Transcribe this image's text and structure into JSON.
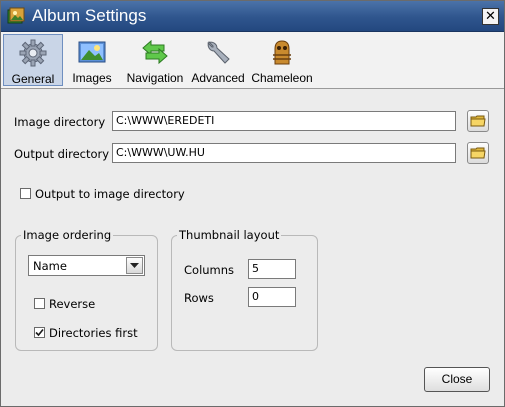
{
  "window": {
    "title": "Album Settings",
    "close_symbol": "✕"
  },
  "toolbar": {
    "tabs": [
      {
        "label": "General",
        "icon": "gear-icon",
        "selected": true
      },
      {
        "label": "Images",
        "icon": "picture-icon",
        "selected": false
      },
      {
        "label": "Navigation",
        "icon": "arrows-icon",
        "selected": false
      },
      {
        "label": "Advanced",
        "icon": "wrench-icon",
        "selected": false
      },
      {
        "label": "Chameleon",
        "icon": "chameleon-icon",
        "selected": false
      }
    ]
  },
  "general": {
    "image_directory": {
      "label": "Image directory",
      "value": "C:\\WWW\\EREDETI"
    },
    "output_directory": {
      "label": "Output directory",
      "value": "C:\\WWW\\UW.HU"
    },
    "output_to_image_directory": {
      "label": "Output to image directory",
      "checked": false
    },
    "image_ordering": {
      "title": "Image ordering",
      "selected": "Name",
      "reverse": {
        "label": "Reverse",
        "checked": false
      },
      "directories_first": {
        "label": "Directories first",
        "checked": true
      }
    },
    "thumbnail_layout": {
      "title": "Thumbnail layout",
      "columns": {
        "label": "Columns",
        "value": "5"
      },
      "rows": {
        "label": "Rows",
        "value": "0"
      }
    }
  },
  "footer": {
    "close_label": "Close"
  },
  "colors": {
    "titlebar": "#2f558d",
    "selected_tab": "#c9d5e7",
    "accent": "#6f8fc0"
  }
}
